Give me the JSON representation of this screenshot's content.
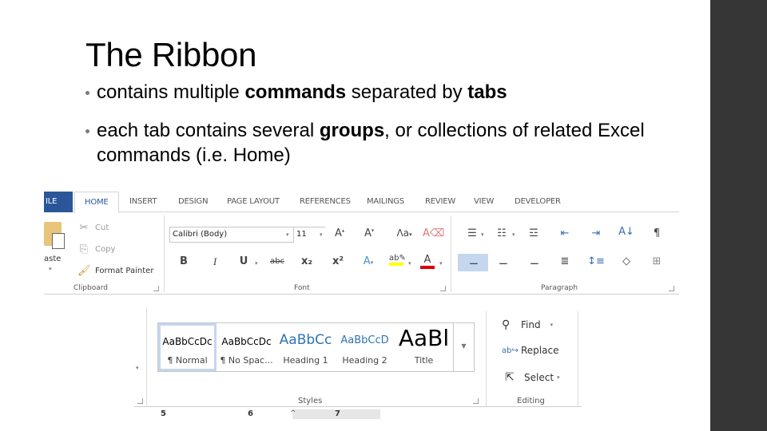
{
  "slide": {
    "title": "The Ribbon",
    "bullets": [
      {
        "parts": [
          {
            "t": "contains multiple ",
            "b": false
          },
          {
            "t": "commands",
            "b": true
          },
          {
            "t": " separated by ",
            "b": false
          },
          {
            "t": "tabs",
            "b": true
          }
        ]
      },
      {
        "parts": [
          {
            "t": "each tab contains several ",
            "b": false
          },
          {
            "t": "groups",
            "b": true
          },
          {
            "t": ", or collections of related Excel commands (i.e. Home)",
            "b": false
          }
        ]
      }
    ]
  },
  "ribbon": {
    "tabs": [
      "FILE",
      "HOME",
      "INSERT",
      "DESIGN",
      "PAGE LAYOUT",
      "REFERENCES",
      "MAILINGS",
      "REVIEW",
      "VIEW",
      "DEVELOPER"
    ],
    "tab_visible_file": "ILE",
    "active_tab": "HOME",
    "file_tab_color": "#2b579a",
    "clipboard": {
      "label": "Clipboard",
      "paste": "Paste",
      "paste_visible": "aste",
      "cut": "Cut",
      "copy": "Copy",
      "format_painter": "Format Painter"
    },
    "font": {
      "label": "Font",
      "font_name": "Calibri (Body)",
      "font_size": "11",
      "bold": "B",
      "italic": "I",
      "underline": "U",
      "strikethrough": "abc",
      "subscript": "x₂",
      "superscript": "x²",
      "highlight_color": "#ffff00",
      "font_color": "#e00000"
    },
    "paragraph": {
      "label": "Paragraph",
      "selected_color": "#c5d6ef"
    },
    "styles": {
      "label": "Styles",
      "items": [
        {
          "sample": "AaBbCcDc",
          "name": "¶ Normal"
        },
        {
          "sample": "AaBbCcDc",
          "name": "¶ No Spac..."
        },
        {
          "sample": "AaBbCc",
          "name": "Heading 1"
        },
        {
          "sample": "AaBbCcD",
          "name": "Heading 2"
        },
        {
          "sample": "AaBl",
          "name": "Title"
        }
      ]
    },
    "editing": {
      "label": "Editing",
      "find": "Find",
      "replace": "Replace",
      "select": "Select"
    },
    "ruler": {
      "marks": [
        "5",
        "6",
        "7"
      ]
    }
  }
}
